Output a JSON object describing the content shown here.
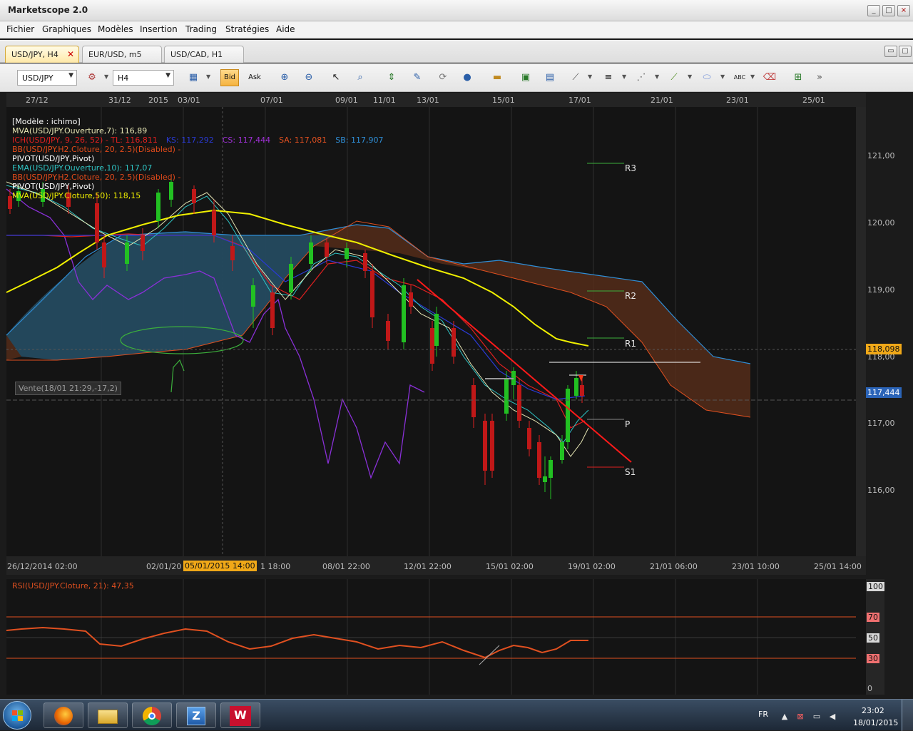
{
  "window": {
    "title": "Marketscope 2.0"
  },
  "menu": [
    "Fichier",
    "Graphiques",
    "Modèles",
    "Insertion",
    "Trading",
    "Stratégies",
    "Aide"
  ],
  "tabs": [
    {
      "label": "USD/JPY, H4",
      "active": true
    },
    {
      "label": "EUR/USD, m5",
      "active": false
    },
    {
      "label": "USD/CAD, H1",
      "active": false
    }
  ],
  "toolbar": {
    "symbol": "USD/JPY",
    "timeframe": "H4",
    "bid_label": "Bid",
    "ask_label": "Ask"
  },
  "chart": {
    "top_dates": [
      "27/12",
      "31/12",
      "2015",
      "03/01",
      "07/01",
      "09/01",
      "11/01",
      "13/01",
      "15/01",
      "17/01",
      "21/01",
      "23/01",
      "25/01"
    ],
    "bottom_dates": [
      "26/12/2014 02:00",
      "02/01/20",
      "05/01/2015 14:00",
      "1 18:00",
      "08/01 22:00",
      "12/01 22:00",
      "15/01 02:00",
      "19/01 02:00",
      "21/01 06:00",
      "23/01 10:00",
      "25/01 14:00"
    ],
    "price_ticks": [
      "121,00",
      "120,00",
      "119,00",
      "118,00",
      "117,00",
      "116,00"
    ],
    "current_price": "117,444",
    "marker_price": "118,098",
    "legend": [
      {
        "text": "[Modèle : ichimo]",
        "color": "#ffffff"
      },
      {
        "text": "MVA(USD/JPY.Ouverture,7): 116,89",
        "color": "#e6e6b4"
      },
      {
        "text": "ICH(USD/JPY, 9, 26, 52) -  TL: 116,811",
        "color": "#e02020"
      },
      {
        "text": "BB(USD/JPY.H2.Cloture, 20, 2.5)(Disabled) -",
        "color": "#e04a1a"
      },
      {
        "text": "PIVOT(USD/JPY,Pivot)",
        "color": "#ffffff"
      },
      {
        "text": "EMA(USD/JPY.Ouverture,10): 117,07",
        "color": "#2fc4c4"
      },
      {
        "text": "BB(USD/JPY.H2.Cloture, 20, 2.5)(Disabled) -",
        "color": "#e04a1a"
      },
      {
        "text": "PIVOT(USD/JPY,Pivot)",
        "color": "#ffffff"
      },
      {
        "text": "MVA(USD/JPY.Cloture,50): 118,15",
        "color": "#f0f000"
      }
    ],
    "legend_extra": [
      {
        "text": "KS: 117,292",
        "color": "#2a3ad4"
      },
      {
        "text": "CS: 117,444",
        "color": "#a030d8"
      },
      {
        "text": "SA: 117,081",
        "color": "#e05020"
      },
      {
        "text": "SB: 117,907",
        "color": "#2f8fd8"
      }
    ],
    "pivots": [
      "R3",
      "R2",
      "R1",
      "P",
      "S1"
    ],
    "trade_label": "Vente(18/01 21:29,-17,2)"
  },
  "rsi": {
    "label": "RSI(USD/JPY.Cloture, 21): 47,35",
    "ticks": [
      "100",
      "70",
      "50",
      "30",
      "0"
    ]
  },
  "taskbar": {
    "language": "FR",
    "time": "23:02",
    "date": "18/01/2015"
  }
}
